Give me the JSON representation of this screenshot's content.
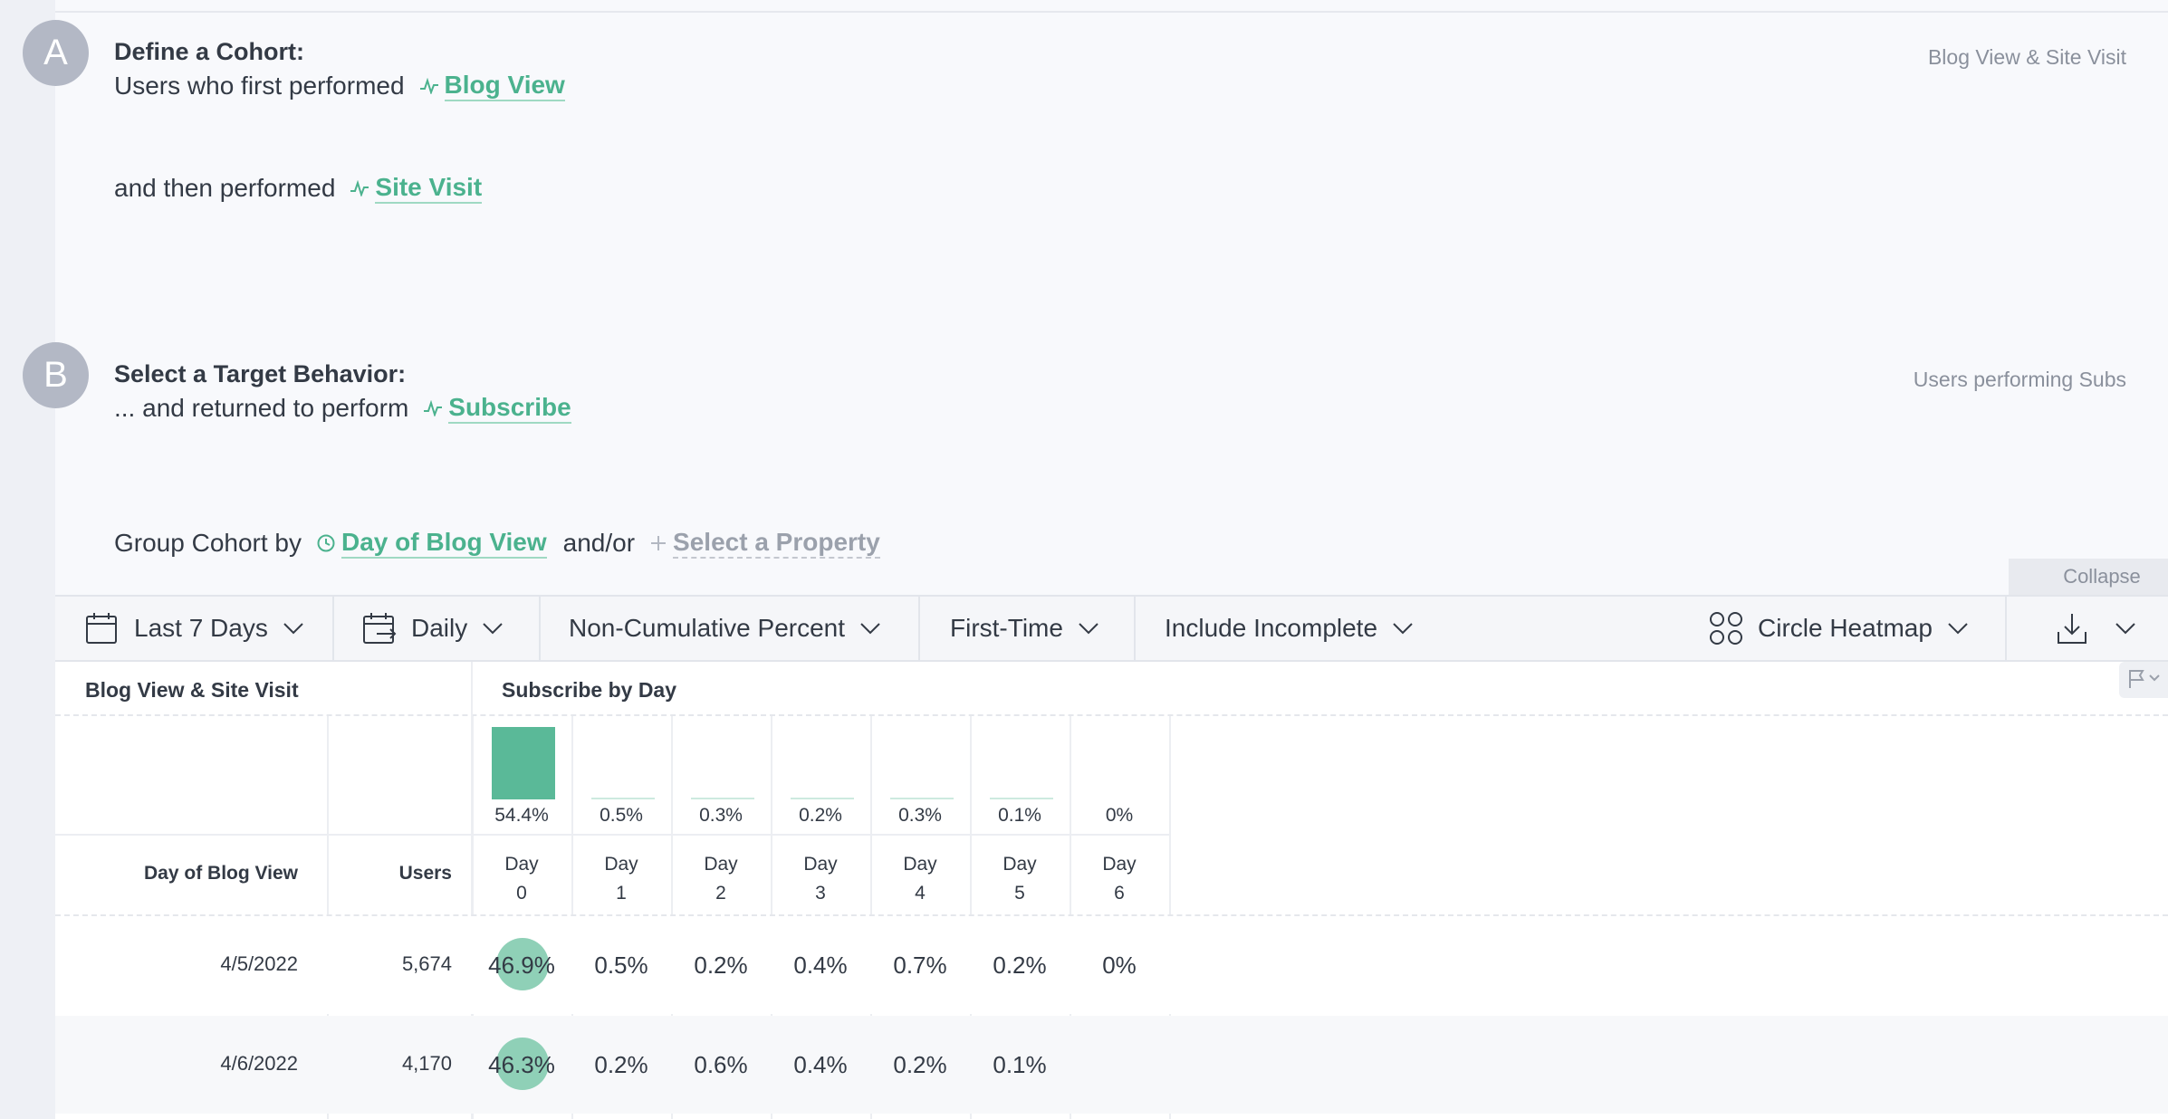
{
  "cohort": {
    "badge": "A",
    "title": "Define a Cohort:",
    "first_text": "Users who first performed",
    "first_event": "Blog View",
    "then_text": "and then performed",
    "then_event": "Site Visit",
    "summary": "Blog View & Site Visit"
  },
  "target": {
    "badge": "B",
    "title": "Select a Target Behavior:",
    "text": "... and returned to perform",
    "event": "Subscribe",
    "summary": "Users performing Subs"
  },
  "group": {
    "text": "Group Cohort by",
    "property": "Day of Blog View",
    "andor": "and/or",
    "add_property": "Select a Property"
  },
  "collapse_label": "Collapse",
  "toolbar": {
    "date_range": "Last 7 Days",
    "interval": "Daily",
    "measure": "Non-Cumulative Percent",
    "occurrence": "First-Time",
    "incomplete": "Include Incomplete",
    "viz": "Circle Heatmap",
    "icons": {
      "date": "calendar-icon",
      "interval": "calendar-repeat-icon",
      "viz": "circle-grid-icon",
      "download": "download-icon"
    }
  },
  "table": {
    "cohort_header": "Blog View & Site Visit",
    "target_header": "Subscribe by Day",
    "group_col": "Day of Blog View",
    "users_col": "Users",
    "summary_bars": [
      {
        "day": "Day",
        "num": "0",
        "pct_label": "54.4%",
        "pct": 54.4
      },
      {
        "day": "Day",
        "num": "1",
        "pct_label": "0.5%",
        "pct": 0.5
      },
      {
        "day": "Day",
        "num": "2",
        "pct_label": "0.3%",
        "pct": 0.3
      },
      {
        "day": "Day",
        "num": "3",
        "pct_label": "0.2%",
        "pct": 0.2
      },
      {
        "day": "Day",
        "num": "4",
        "pct_label": "0.3%",
        "pct": 0.3
      },
      {
        "day": "Day",
        "num": "5",
        "pct_label": "0.1%",
        "pct": 0.1
      },
      {
        "day": "Day",
        "num": "6",
        "pct_label": "0%",
        "pct": 0
      }
    ],
    "rows": [
      {
        "date": "4/5/2022",
        "users": "5,674",
        "cells": [
          "46.9%",
          "0.5%",
          "0.2%",
          "0.4%",
          "0.7%",
          "0.2%",
          "0%"
        ]
      },
      {
        "date": "4/6/2022",
        "users": "4,170",
        "cells": [
          "46.3%",
          "0.2%",
          "0.6%",
          "0.4%",
          "0.2%",
          "0.1%"
        ]
      }
    ]
  },
  "colors": {
    "accent": "#4bb28e",
    "bar": "#5ab998",
    "circle": "#8fd0b7"
  }
}
